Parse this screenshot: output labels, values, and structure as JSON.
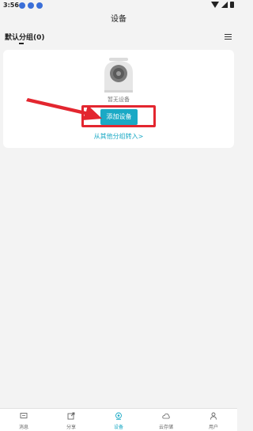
{
  "status_bar": {
    "time": "3:56"
  },
  "title": "设备",
  "group": {
    "name": "默认分组(0)"
  },
  "empty_state": {
    "text": "暂无设备",
    "add_button": "添加设备",
    "transfer_link": "从其他分组转入>"
  },
  "tabs": [
    {
      "label": "消息",
      "icon": "message-icon"
    },
    {
      "label": "分享",
      "icon": "share-icon"
    },
    {
      "label": "设备",
      "icon": "camera-icon",
      "active": true
    },
    {
      "label": "云存储",
      "icon": "cloud-icon"
    },
    {
      "label": "用户",
      "icon": "user-icon"
    }
  ],
  "colors": {
    "accent": "#1aa9c5",
    "highlight": "#e3262f",
    "background": "#f3f3f3"
  }
}
